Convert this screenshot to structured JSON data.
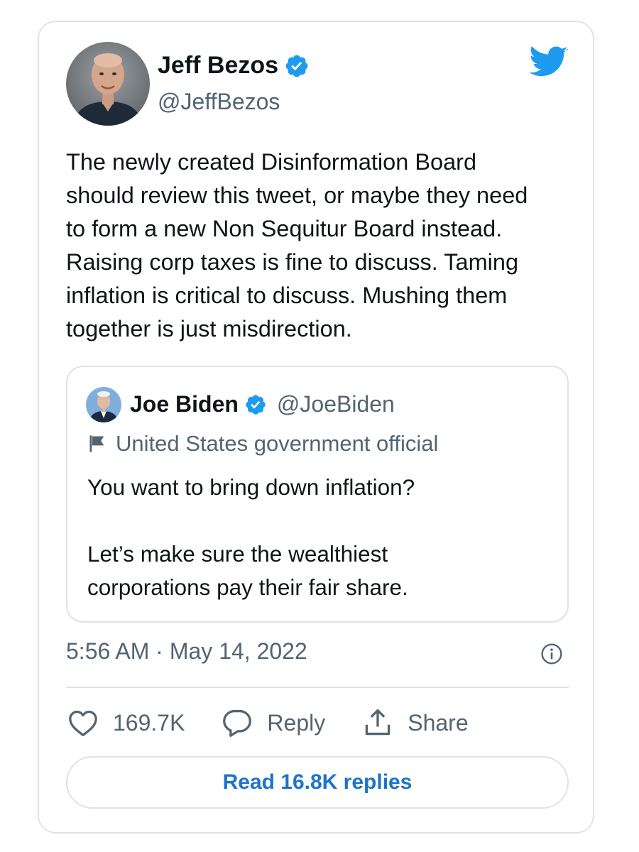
{
  "tweet": {
    "author": {
      "name": "Jeff Bezos",
      "handle": "@JeffBezos",
      "verified": true
    },
    "text_lines": [
      "The newly created Disinformation Board",
      "should review this tweet, or maybe they need",
      "to form a new Non Sequitur Board instead.",
      "Raising corp taxes is fine to discuss. Taming",
      "inflation is critical to discuss. Mushing them",
      "together is just misdirection."
    ],
    "timestamp": "5:56 AM · May 14, 2022"
  },
  "quoted_tweet": {
    "author": {
      "name": "Joe Biden",
      "handle": "@JoeBiden",
      "verified": true
    },
    "label": "United States government official",
    "text_lines": [
      "You want to bring down inflation?",
      "",
      "Let’s make sure the wealthiest",
      "corporations pay their fair share."
    ]
  },
  "actions": {
    "like_count": "169.7K",
    "reply_label": "Reply",
    "share_label": "Share"
  },
  "read_replies_label": "Read 16.8K replies",
  "colors": {
    "twitter_blue": "#1d9bf0",
    "link_blue": "#1d74c9",
    "text_primary": "#0f1419",
    "text_secondary": "#536471",
    "border": "#dde3e8"
  },
  "icons": {
    "brand": "twitter-bird-icon",
    "verified": "verified-badge-icon",
    "label": "flag-icon",
    "info": "info-icon",
    "like": "heart-icon",
    "reply": "speech-bubble-icon",
    "share": "share-upload-icon"
  }
}
